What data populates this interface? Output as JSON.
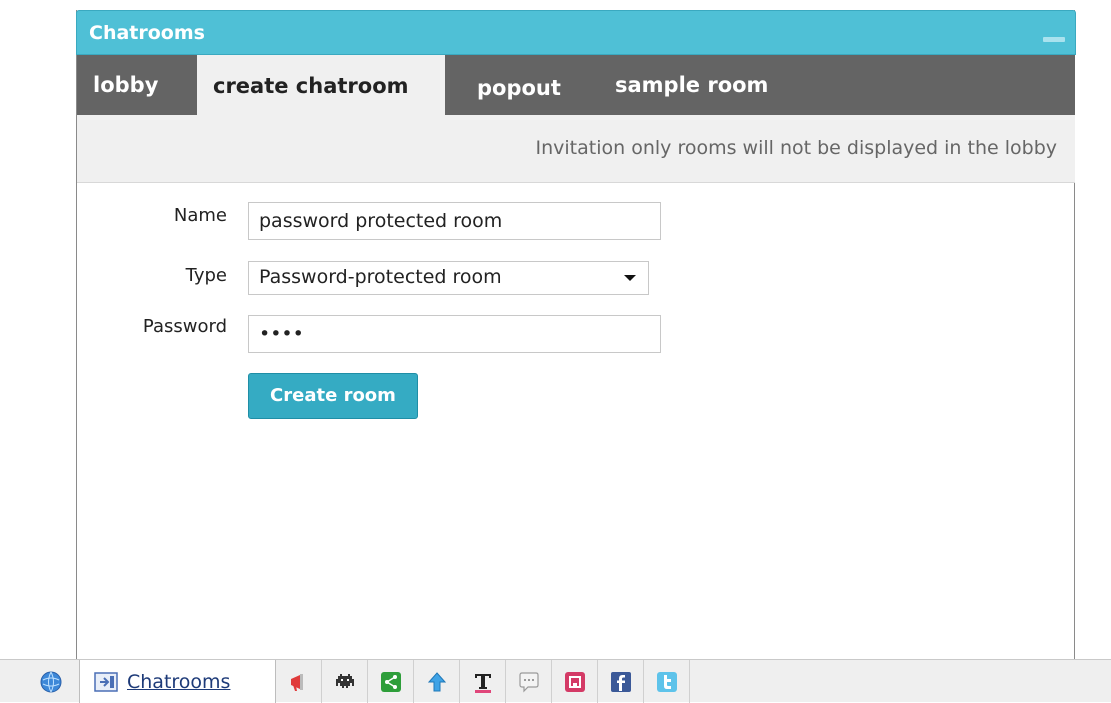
{
  "window": {
    "title": "Chatrooms",
    "tabs": [
      {
        "label": "lobby",
        "active": false
      },
      {
        "label": "create chatroom",
        "active": true
      },
      {
        "label": "popout",
        "active": false
      },
      {
        "label": "sample room",
        "active": false
      }
    ],
    "notice": "Invitation only rooms will not be displayed in the lobby"
  },
  "form": {
    "name_label": "Name",
    "name_value": "password protected room",
    "type_label": "Type",
    "type_value": "Password-protected room",
    "password_label": "Password",
    "password_value": "abcd",
    "submit_label": "Create room"
  },
  "taskbar": {
    "active_label": "Chatrooms",
    "icons": [
      "globe-icon",
      "chatrooms-icon",
      "announcement-icon",
      "space-invader-icon",
      "share-icon",
      "upload-arrow-icon",
      "text-format-icon",
      "chat-bubble-icon",
      "save-icon",
      "facebook-icon",
      "twitter-icon"
    ]
  },
  "colors": {
    "title_bar": "#4fc0d6",
    "tab_bar": "#646464",
    "button": "#35abc3"
  }
}
